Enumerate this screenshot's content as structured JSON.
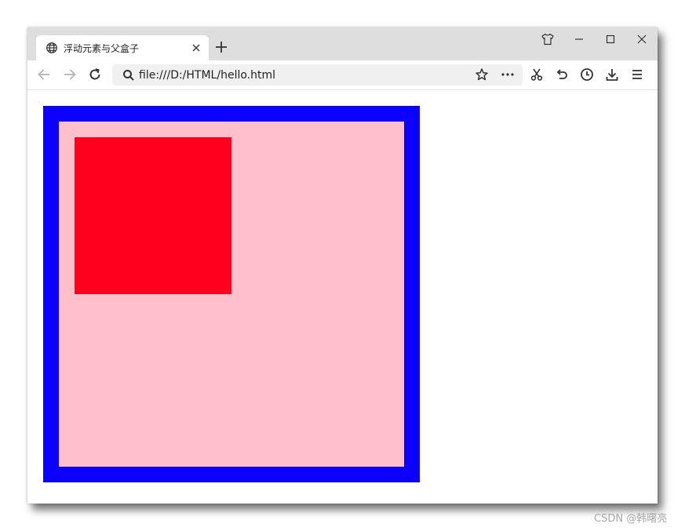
{
  "tab": {
    "title": "浮动元素与父盒子"
  },
  "address_bar": {
    "url": "file:///D:/HTML/hello.html"
  },
  "page": {
    "parent_box": {
      "background": "#ffc0cb",
      "border_color": "#0c00ff"
    },
    "floated_child": {
      "background": "#ff001f"
    }
  },
  "watermark": "CSDN @韩曙亮",
  "icons": {
    "tab": "globe-icon",
    "tab_close": "close-icon",
    "new_tab": "plus-icon",
    "skin": "shirt-icon",
    "minimize": "minimize-icon",
    "maximize": "maximize-icon",
    "close": "close-icon",
    "back": "back-arrow-icon",
    "forward": "forward-arrow-icon",
    "reload": "reload-icon",
    "search": "search-icon",
    "bookmark": "star-icon",
    "more": "more-icon",
    "screenshot": "scissors-icon",
    "undo": "undo-icon",
    "history": "clock-icon",
    "download": "download-icon",
    "menu": "menu-icon"
  }
}
